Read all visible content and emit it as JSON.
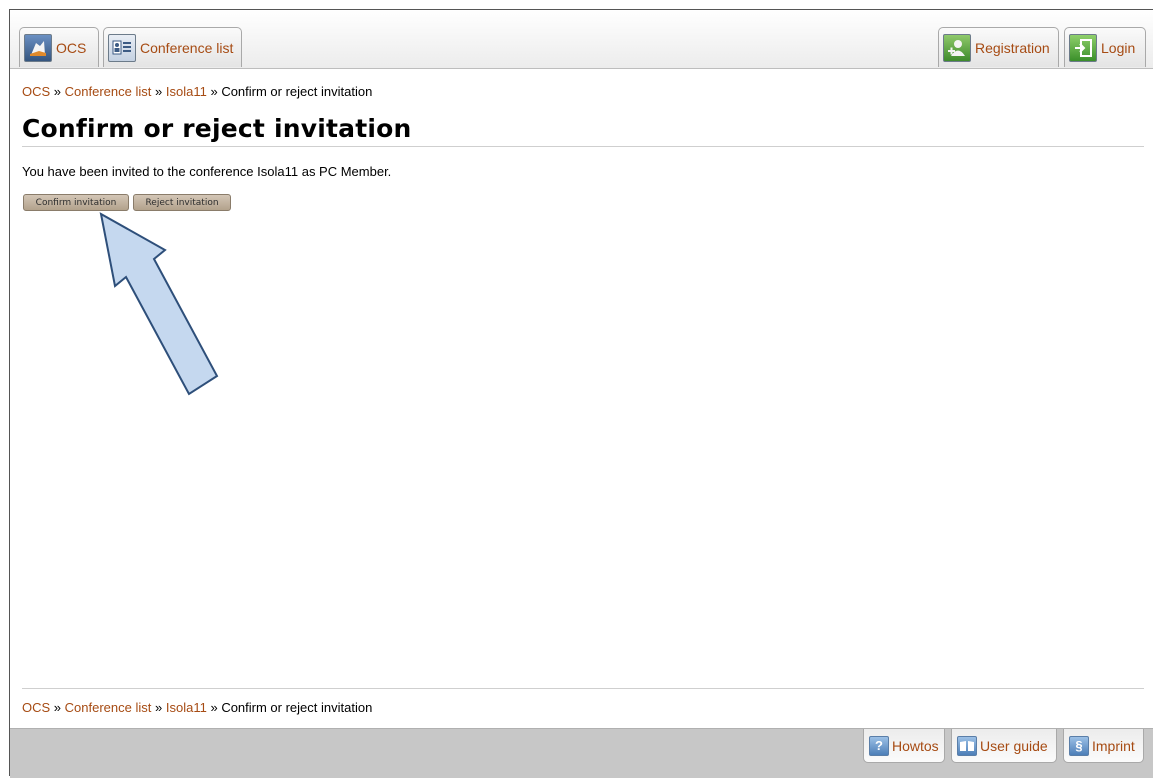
{
  "nav": {
    "ocs": "OCS",
    "conference_list": "Conference list",
    "registration": "Registration",
    "login": "Login"
  },
  "breadcrumb": {
    "items": [
      "OCS",
      "Conference list",
      "Isola11"
    ],
    "separator": "»",
    "current": "Confirm or reject invitation"
  },
  "page": {
    "title": "Confirm or reject invitation",
    "message": "You have been invited to the conference Isola11 as PC Member.",
    "confirm_label": "Confirm invitation",
    "reject_label": "Reject invitation"
  },
  "footer": {
    "howtos": "Howtos",
    "user_guide": "User guide",
    "imprint": "Imprint"
  },
  "colors": {
    "link": "#a64b13",
    "button": "#c2b4a2",
    "arrow_fill": "#c5d8ef",
    "arrow_stroke": "#2e4f7a",
    "footer_bar": "#c7c7c7"
  }
}
